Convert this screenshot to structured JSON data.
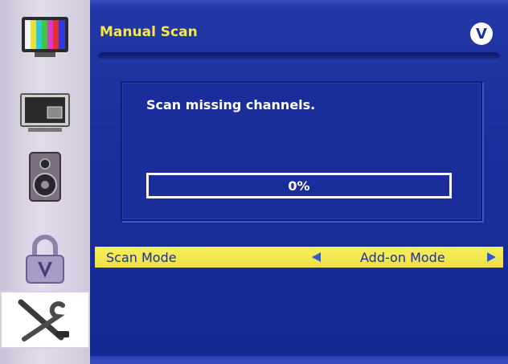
{
  "menu": {
    "title": "Manual Scan",
    "logo": "V"
  },
  "sidebar": {
    "items": [
      {
        "name": "picture-icon"
      },
      {
        "name": "screen-icon"
      },
      {
        "name": "speaker-icon"
      },
      {
        "name": "lock-icon"
      },
      {
        "name": "tools-icon",
        "active": true
      }
    ]
  },
  "scan": {
    "message": "Scan missing channels.",
    "progress_label": "0%",
    "progress_fraction": 0
  },
  "scan_mode": {
    "label": "Scan Mode",
    "value": "Add-on Mode"
  },
  "colors": {
    "panel_blue": "#1c2f9e",
    "title_yellow": "#f4e84a",
    "highlight_yellow": "#f2e64e",
    "arrow_blue": "#2f5ad8"
  }
}
